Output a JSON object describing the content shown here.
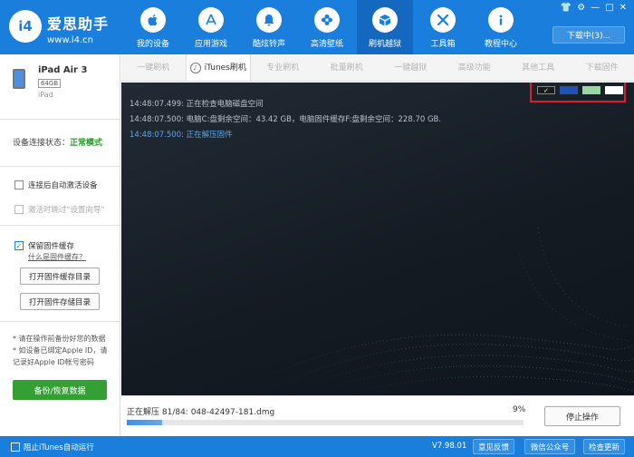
{
  "app": {
    "brand_name": "爱思助手",
    "brand_url": "www.i4.cn",
    "logo_text": "i4"
  },
  "nav": {
    "items": [
      {
        "label": "我的设备",
        "icon": "apple-icon"
      },
      {
        "label": "应用游戏",
        "icon": "app-store-icon"
      },
      {
        "label": "酷炫铃声",
        "icon": "bell-icon"
      },
      {
        "label": "高清壁纸",
        "icon": "flower-icon"
      },
      {
        "label": "刷机越狱",
        "icon": "box-icon"
      },
      {
        "label": "工具箱",
        "icon": "tools-icon"
      },
      {
        "label": "教程中心",
        "icon": "info-icon"
      }
    ],
    "active_index": 4,
    "download_label": "下载中(3)..."
  },
  "sidebar": {
    "device_name": "iPad Air 3",
    "device_capacity": "64GB",
    "device_type": "iPad",
    "connection_label": "设备连接状态：",
    "connection_mode": "正常模式",
    "auto_activate_label": "连接后自动激活设备",
    "skip_setup_label": "激活时跳过\"设置向导\"",
    "keep_cache_label": "保留固件缓存",
    "what_is_cache_link": "什么是固件缓存？",
    "open_cache_dir_label": "打开固件缓存目录",
    "open_storage_dir_label": "打开固件存储目录",
    "tip_1": "* 请在操作前备份好您的数据",
    "tip_2": "* 如设备已绑定Apple ID，请记录好Apple ID帐号密码",
    "backup_label": "备份/恢复数据"
  },
  "tabs": {
    "items": [
      "一键刷机",
      "iTunes刷机",
      "专业刷机",
      "批量刷机",
      "一键越狱",
      "高级功能",
      "其他工具",
      "下载固件"
    ],
    "active_index": 1
  },
  "console": {
    "lines": [
      {
        "time": "14:48:07.499:",
        "text": "正在检查电脑磁盘空间"
      },
      {
        "time": "14:48:07.500:",
        "text": "电脑C:盘剩余空间：43.42 GB，电脑固件缓存F:盘剩余空间：228.70 GB."
      },
      {
        "time": "14:48:07.500:",
        "text": "正在解压固件"
      }
    ],
    "swatch_check": "✓",
    "theme_colors": [
      "#1a1a1a",
      "#1f52b3",
      "#9bd6a0",
      "#ffffff"
    ]
  },
  "progress": {
    "label": "正在解压 81/84: 048-42497-181.dmg",
    "percent_text": "9%",
    "percent_value": 9,
    "stop_label": "停止操作"
  },
  "statusbar": {
    "block_itunes_label": "阻止iTunes自动运行",
    "version": "V7.98.01",
    "feedback_label": "意见反馈",
    "wechat_label": "微信公众号",
    "update_label": "检查更新"
  },
  "colors": {
    "primary": "#1a7fdc",
    "success": "#34a034",
    "console_bg": "#18202a",
    "highlight": "#d9202a"
  }
}
